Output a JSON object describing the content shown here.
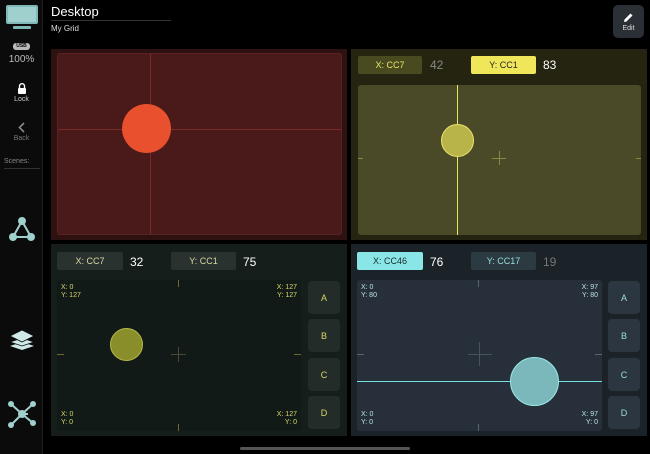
{
  "sidebar": {
    "monitor_icon": "desktop-monitor-icon",
    "usb_badge": "USB",
    "zoom": "100%",
    "lock_label": "Lock",
    "back_label": "Back",
    "scenes_label": "Scenes:"
  },
  "header": {
    "title": "Desktop",
    "subtitle": "My Grid",
    "edit_label": "Edit"
  },
  "colors": {
    "orange": "#e8502e",
    "yellow": "#e8e46a",
    "olive": "#8a8e2a",
    "cyan": "#7ae0e0"
  },
  "panels": {
    "p1": {
      "name": "xy-pad-red"
    },
    "p2": {
      "x_tag": "X: CC7",
      "x_value": "42",
      "y_tag": "Y: CC1",
      "y_value": "83"
    },
    "p3": {
      "x_tag": "X: CC7",
      "x_value": "32",
      "y_tag": "Y: CC1",
      "y_value": "75",
      "corner_tl": [
        "X: 0",
        "Y: 127"
      ],
      "corner_tr": [
        "X: 127",
        "Y: 127"
      ],
      "corner_bl": [
        "X: 0",
        "Y: 0"
      ],
      "corner_br": [
        "X: 127",
        "Y: 0"
      ],
      "buttons": [
        "A",
        "B",
        "C",
        "D"
      ]
    },
    "p4": {
      "x_tag": "X: CC46",
      "x_value": "76",
      "y_tag": "Y: CC17",
      "y_value": "19",
      "corner_tl": [
        "X: 0",
        "Y: 80"
      ],
      "corner_tr": [
        "X: 97",
        "Y: 80"
      ],
      "corner_bl": [
        "X: 0",
        "Y: 0"
      ],
      "corner_br": [
        "X: 97",
        "Y: 0"
      ],
      "buttons": [
        "A",
        "B",
        "C",
        "D"
      ]
    }
  }
}
